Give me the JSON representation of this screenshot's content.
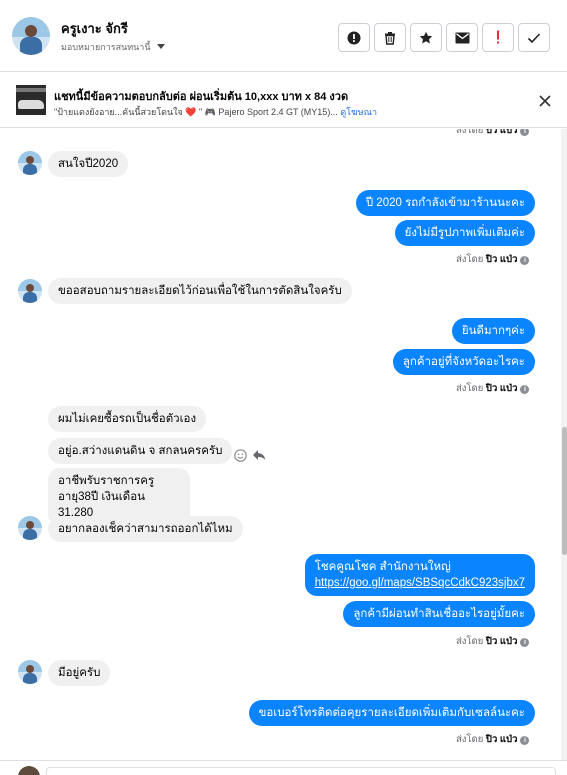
{
  "header": {
    "name": "ครูเงาะ จักรี",
    "assignee": "มอบหมายการสนทนานี้",
    "tools": [
      {
        "icon": "alert-circle-icon",
        "name": "mark-spam-button"
      },
      {
        "icon": "trash-icon",
        "name": "delete-button"
      },
      {
        "icon": "star-icon",
        "name": "star-button"
      },
      {
        "icon": "envelope-icon",
        "name": "mark-unread-button"
      },
      {
        "icon": "exclamation-icon",
        "name": "mark-follow-up-button"
      },
      {
        "icon": "check-icon",
        "name": "mark-done-button"
      }
    ]
  },
  "ad": {
    "title": "แชทนี้มีข้อความตอบกลับต่อ ผ่อนเริ่มต้น 10,xxx บาท x 84 งวด",
    "desc": "\"ป้ายแดงยังอาย...คันนี้สวยโดนใจ ❤️ \" 🎮 Pajero Sport 2.4 GT (MY15)...",
    "link": "ดูโฆษณา"
  },
  "messages": {
    "top_seen": "ส่งโดย ปิว แป่ว",
    "m1": "สนใจปี2020",
    "m2": "ปี 2020 รถกำลังเข้ามาร้านนะคะ",
    "m3": "ยังไม่มีรูปภาพเพิ่มเติมค่ะ",
    "seen_prefix": "ส่งโดย",
    "seen_name": "ปิว แป่ว",
    "m4": "ขออสอบถามรายละเอียดไว้ก่อนเพื่อใช้ในการตัดสินใจครับ",
    "m5": "ยินดีมากๆค่ะ",
    "m6": "ลูกค้าอยู่ที่จังหวัดอะไรคะ",
    "m7": "ผมไม่เคยซื้อรถเป็นชื่อตัวเอง",
    "m8": "อยู่อ.สว่างแดนดิน จ สกลนครครับ",
    "m9_line1": "อาชีพรับราชการครู",
    "m9_line2": "อายุ38ปี เงินเดือน 31,280",
    "m10": "อยากลองเช็คว่าสามารถออกได้ไหม",
    "m11_line1": "โชคคูณโชค สำนักงานใหญ่",
    "m11_link": "https://goo.gl/maps/SBSqcCdkC923sjbx7",
    "m12": "ลูกค้ามีผ่อนทำสินเชื่ออะไรอยู่มั้ยคะ",
    "m13": "มีอยู่ครับ",
    "m14": "ขอเบอร์โทรติดต่อคุยรายละเอียดเพิ่มเติมกับเซลล์นะคะ"
  },
  "colors": {
    "outgoing": "#0b84ff",
    "incoming": "#f0f0f0"
  }
}
